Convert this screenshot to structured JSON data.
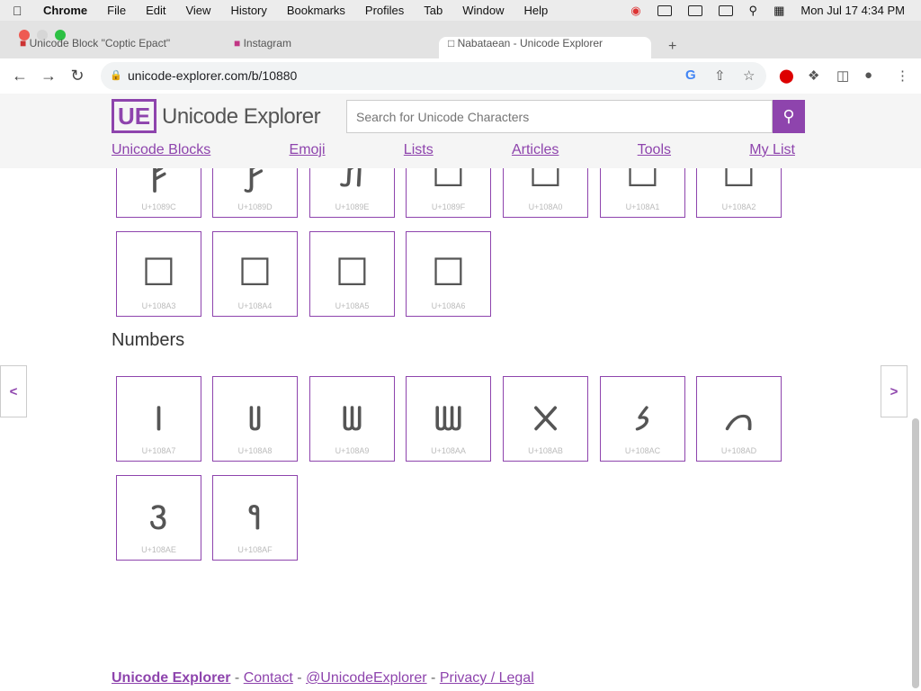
{
  "menubar": {
    "app": "Chrome",
    "items": [
      "File",
      "Edit",
      "View",
      "History",
      "Bookmarks",
      "Profiles",
      "Tab",
      "Window",
      "Help"
    ],
    "datetime": "Mon Jul 17  4:34 PM"
  },
  "tabs": [
    {
      "title": "Unicode Block \"Coptic Epact\""
    },
    {
      "title": "Instagram"
    },
    {
      "title": "Nabataean - Unicode Explorer"
    }
  ],
  "toolbar": {
    "url": "unicode-explorer.com/b/10880"
  },
  "site": {
    "logo_mark": "UE",
    "logo_text": "Unicode Explorer",
    "search_placeholder": "Search for Unicode Characters",
    "nav": [
      "Unicode Blocks",
      "Emoji",
      "Lists",
      "Articles",
      "Tools",
      "My List"
    ]
  },
  "letters_row1": [
    {
      "glyph": "𐢜",
      "code": "U+1089C"
    },
    {
      "glyph": "𐢝",
      "code": "U+1089D"
    },
    {
      "glyph": "𐢞",
      "code": "U+1089E"
    },
    {
      "glyph": "☐",
      "code": "U+1089F"
    },
    {
      "glyph": "☐",
      "code": "U+108A0"
    },
    {
      "glyph": "☐",
      "code": "U+108A1"
    },
    {
      "glyph": "☐",
      "code": "U+108A2"
    }
  ],
  "letters_row2": [
    {
      "glyph": "☐",
      "code": "U+108A3"
    },
    {
      "glyph": "☐",
      "code": "U+108A4"
    },
    {
      "glyph": "☐",
      "code": "U+108A5"
    },
    {
      "glyph": "☐",
      "code": "U+108A6"
    }
  ],
  "numbers_title": "Numbers",
  "numbers_row1": [
    {
      "glyph": "𐢧",
      "code": "U+108A7"
    },
    {
      "glyph": "𐢨",
      "code": "U+108A8"
    },
    {
      "glyph": "𐢩",
      "code": "U+108A9"
    },
    {
      "glyph": "𐢪",
      "code": "U+108AA"
    },
    {
      "glyph": "𐢫",
      "code": "U+108AB"
    },
    {
      "glyph": "𐢬",
      "code": "U+108AC"
    },
    {
      "glyph": "𐢭",
      "code": "U+108AD"
    }
  ],
  "numbers_row2": [
    {
      "glyph": "𐢮",
      "code": "U+108AE"
    },
    {
      "glyph": "𐢯",
      "code": "U+108AF"
    }
  ],
  "pager": {
    "prev": "<",
    "next": ">"
  },
  "footer": {
    "brand": "Unicode Explorer",
    "sep": " - ",
    "contact": "Contact",
    "twitter": "@UnicodeExplorer",
    "privacy": "Privacy / Legal"
  },
  "colors": {
    "accent": "#8e44ad"
  }
}
